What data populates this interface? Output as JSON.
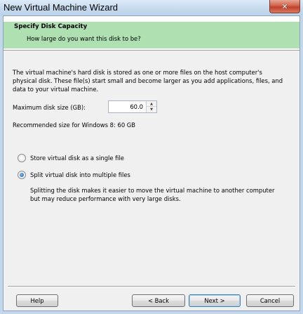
{
  "window": {
    "title": "New Virtual Machine Wizard",
    "close_label": "✕"
  },
  "header": {
    "title": "Specify Disk Capacity",
    "subtitle": "How large do you want this disk to be?"
  },
  "body": {
    "description": "The virtual machine's hard disk is stored as one or more files on the host computer's physical disk. These file(s) start small and become larger as you add applications, files, and data to your virtual machine.",
    "max_size_label": "Maximum disk size (GB):",
    "max_size_value": "60.0",
    "recommended": "Recommended size for Windows 8: 60 GB",
    "options": [
      {
        "label": "Store virtual disk as a single file",
        "checked": false
      },
      {
        "label": "Split virtual disk into multiple files",
        "checked": true
      }
    ],
    "split_description": "Splitting the disk makes it easier to move the virtual machine to another computer but may reduce performance with very large disks."
  },
  "buttons": {
    "help": "Help",
    "back": "< Back",
    "next": "Next >",
    "cancel": "Cancel"
  }
}
